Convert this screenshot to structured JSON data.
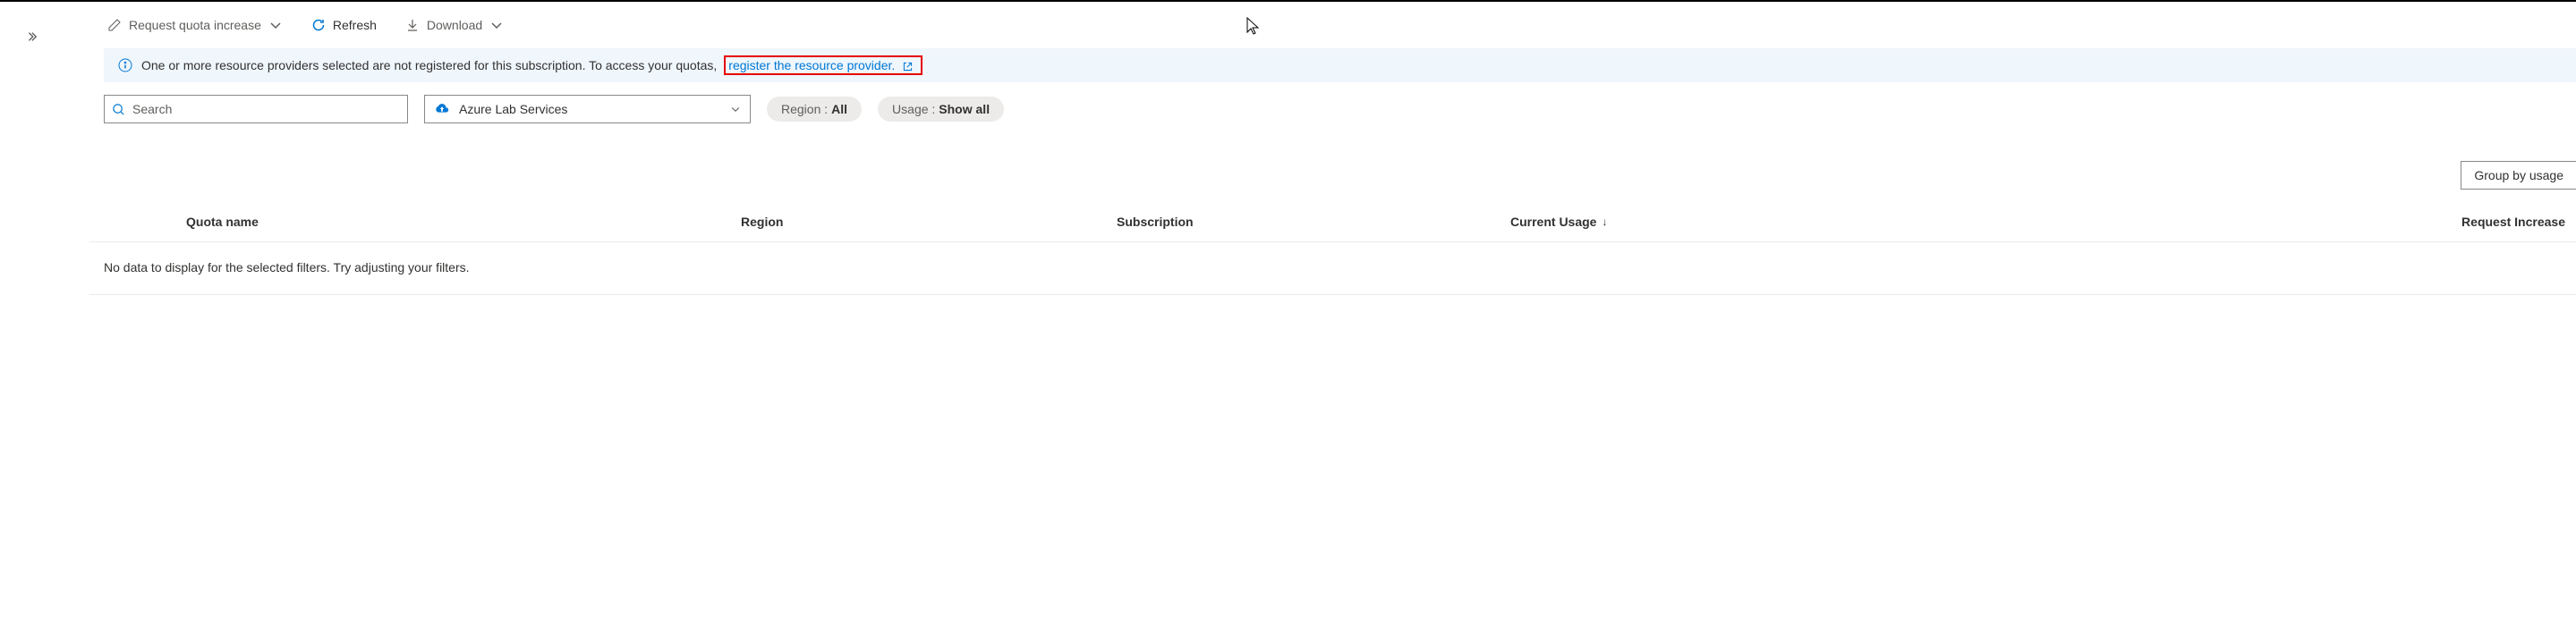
{
  "toolbar": {
    "request_increase": "Request quota increase",
    "refresh": "Refresh",
    "download": "Download"
  },
  "banner": {
    "message": "One or more resource providers selected are not registered for this subscription. To access your quotas,",
    "link_text": "register the resource provider."
  },
  "filters": {
    "search_placeholder": "Search",
    "provider": "Azure Lab Services",
    "region_label": "Region :",
    "region_value": "All",
    "usage_label": "Usage :",
    "usage_value": "Show all"
  },
  "group_dd": "Group by usage",
  "table": {
    "headers": {
      "quota_name": "Quota name",
      "region": "Region",
      "subscription": "Subscription",
      "current_usage": "Current Usage",
      "request_increase": "Request Increase"
    },
    "empty_message": "No data to display for the selected filters. Try adjusting your filters."
  }
}
